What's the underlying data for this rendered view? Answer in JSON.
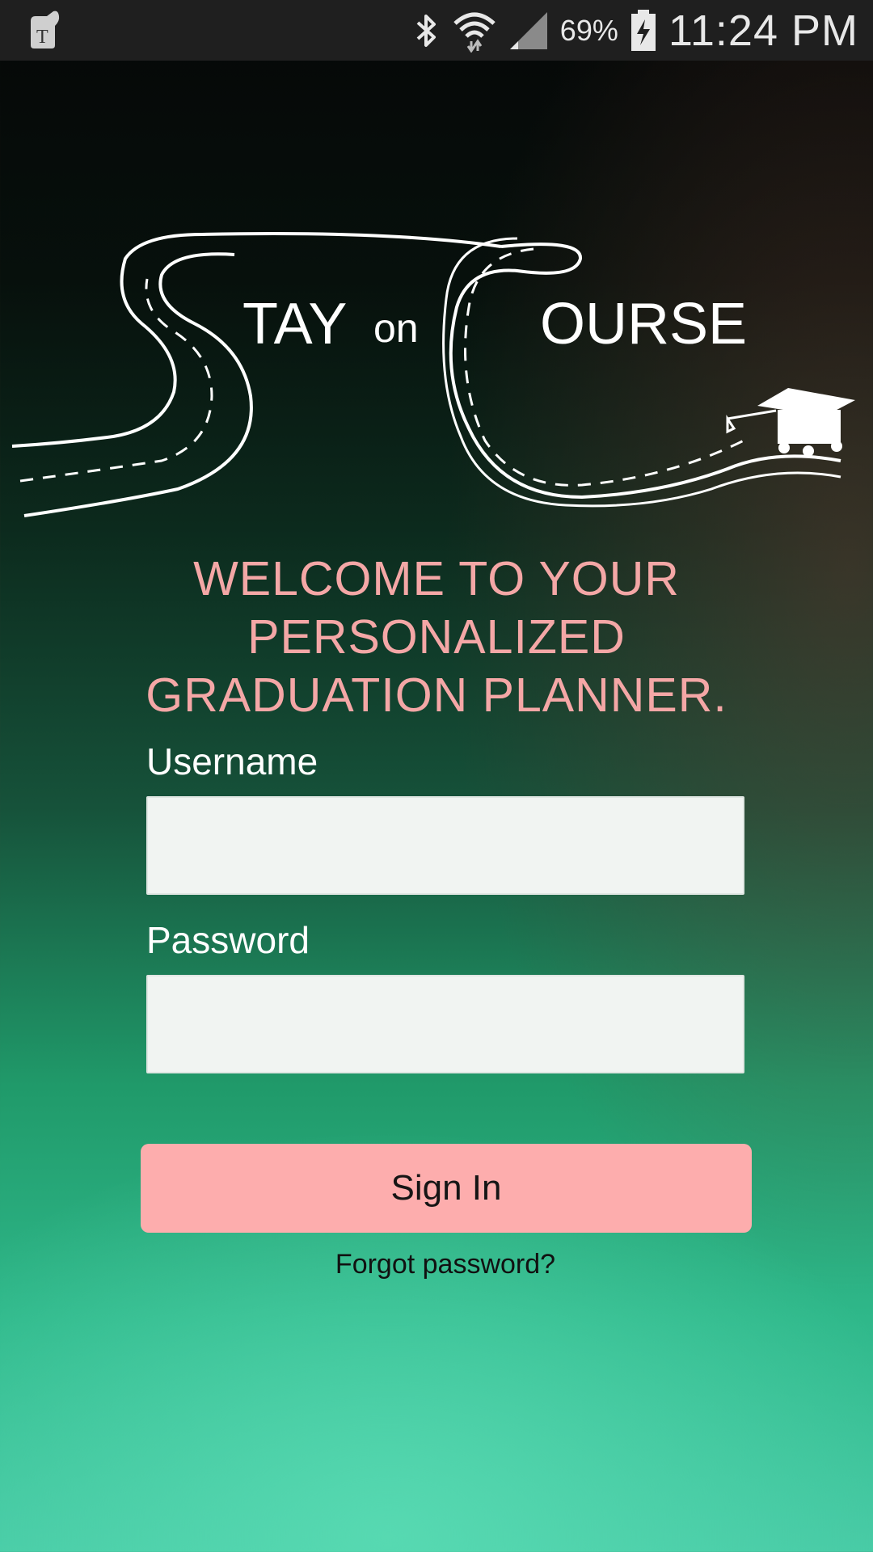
{
  "status_bar": {
    "app_icon": "carrier-app-icon",
    "bluetooth_icon": "bluetooth-icon",
    "wifi_icon": "wifi-icon",
    "signal_icon": "cell-signal-icon",
    "battery_percent": "69%",
    "battery_icon": "battery-charging-icon",
    "time": "11:24 PM"
  },
  "logo": {
    "word_stay": "TAY",
    "word_on": "on",
    "word_course": "OURSE",
    "graduation_cap_icon": "graduation-cap-icon"
  },
  "welcome": {
    "line1": "WELCOME TO YOUR PERSONALIZED",
    "line2": "GRADUATION PLANNER."
  },
  "form": {
    "username_label": "Username",
    "username_value": "",
    "password_label": "Password",
    "password_value": "",
    "sign_in_label": "Sign In",
    "forgot_password_label": "Forgot password?"
  },
  "colors": {
    "accent": "#fdadad",
    "welcome_text": "#f4a7a6",
    "status_bar": "#1f1f1f"
  }
}
